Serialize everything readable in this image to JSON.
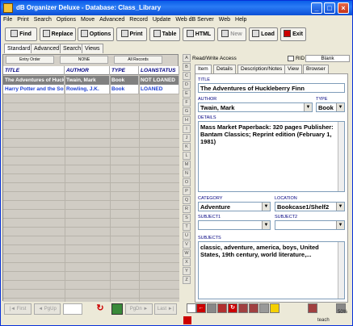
{
  "window": {
    "title": "dB Organizer Deluxe - Database: Class_Library",
    "minimize": "_",
    "maximize": "□",
    "close": "×"
  },
  "menu": [
    "File",
    "Print",
    "Search",
    "Options",
    "Move",
    "Advanced",
    "Record",
    "Update",
    "Web dB Server",
    "Web",
    "Help"
  ],
  "toolbar": {
    "find": "Find",
    "replace": "Replace",
    "options": "Options",
    "print": "Print",
    "table": "Table",
    "html": "HTML",
    "new": "New",
    "load": "Load",
    "exit": "Exit"
  },
  "view_tabs": [
    "Standard",
    "Advanced",
    "Search",
    "Views"
  ],
  "sort_buttons": {
    "entry_order": "Entry Order",
    "none": "NONE",
    "all_records": "All Records"
  },
  "grid": {
    "columns": [
      "TITLE",
      "AUTHOR",
      "TYPE",
      "LOANSTATUS"
    ],
    "rows": [
      [
        "The Adventures of Huckleberry Finn",
        "Twain, Mark",
        "Book",
        "NOT LOANED"
      ],
      [
        "Harry Potter and the Sorcerer's Stone",
        "Rowling, J.K.",
        "Book",
        "LOANED"
      ]
    ]
  },
  "nav": {
    "first": "First",
    "pgup": "PgUp",
    "pgdn": "PgDn",
    "last": "Last"
  },
  "letters": [
    "A",
    "B",
    "C",
    "D",
    "E",
    "F",
    "G",
    "H",
    "I",
    "J",
    "K",
    "L",
    "M",
    "N",
    "O",
    "P",
    "Q",
    "R",
    "S",
    "T",
    "U",
    "V",
    "W",
    "X",
    "Y",
    "Z"
  ],
  "record": {
    "access": "Read/Write Access",
    "rid_label": "RID",
    "rid_value": "Blank",
    "tabs": [
      "Item",
      "Details",
      "Description/Notes",
      "View",
      "Browser"
    ],
    "title_label": "TITLE",
    "title": "The Adventures of Huckleberry Finn",
    "author_label": "AUTHOR",
    "author": "Twain, Mark",
    "type_label": "TYPE",
    "type": "Book",
    "details_label": "DETAILS",
    "details": "Mass Market Paperback: 320 pages Publisher: Bantam Classics; Reprint edition (February 1, 1981)",
    "category_label": "CATEGORY",
    "category": "Adventure",
    "location_label": "LOCATION",
    "location": "Bookcase1/Shelf2",
    "subject1_label": "SUBJECT1",
    "subject1": "",
    "subject2_label": "SUBJECT2",
    "subject2": "",
    "subjects_label": "SUBJECTS",
    "subjects": "classic, adventure, america, boys, United States, 19th century, world literature,..."
  },
  "status": {
    "zoom": "50%",
    "user": "teach"
  }
}
